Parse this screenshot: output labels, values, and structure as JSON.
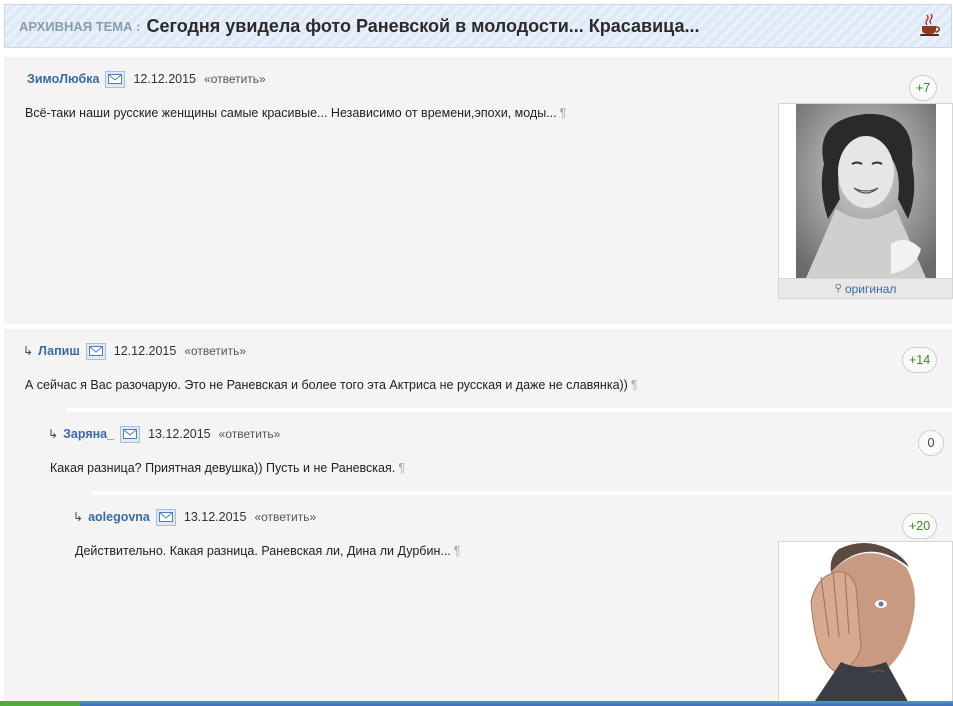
{
  "header": {
    "archive_label": "АРХИВНАЯ ТЕМА :",
    "title": "Сегодня увидела фото Раневской в молодости... Красавица..."
  },
  "comments": [
    {
      "author": "ЗимоЛюбка",
      "date": "12.12.2015",
      "reply_label": "«ответить»",
      "text": "Всё-таки наши русские женщины самые красивые... Независимо от времени,эпохи, моды...",
      "pilcrow": "¶",
      "rating": "+7",
      "photo_caption": "оригинал"
    },
    {
      "reply_arrow": "↳",
      "author": "Лапиш",
      "date": "12.12.2015",
      "reply_label": "«ответить»",
      "text": "А сейчас я Вас разочарую. Это не Раневская и более того эта Актриса не русская и даже не славянка))",
      "pilcrow": "¶",
      "rating": "+14"
    },
    {
      "reply_arrow": "↳",
      "author": "Заряна_",
      "date": "13.12.2015",
      "reply_label": "«ответить»",
      "text": "Какая разница? Приятная девушка)) Пусть и не Раневская.",
      "pilcrow": "¶",
      "rating": "0"
    },
    {
      "reply_arrow": "↳",
      "author": "aolegovna",
      "date": "13.12.2015",
      "reply_label": "«ответить»",
      "text": "Действительно. Какая разница. Раневская ли, Дина ли Дурбин...",
      "pilcrow": "¶",
      "rating": "+20"
    }
  ],
  "colors": {
    "author_link": "#3b6aa8",
    "rating_positive": "#3a8a1e",
    "archive_label": "#8a9bb0"
  }
}
